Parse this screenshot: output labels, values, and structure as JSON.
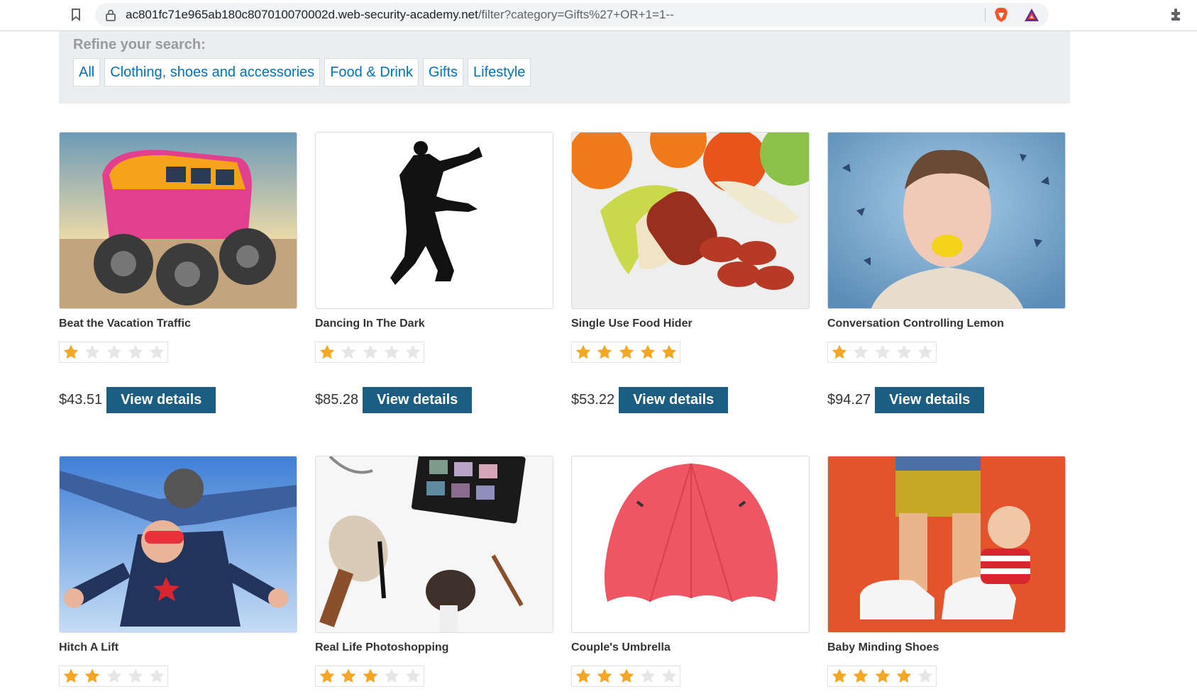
{
  "browser": {
    "url_host": "ac801fc71e965ab180c807010070002d.web-security-academy.net",
    "url_path": "/filter?category=Gifts%27+OR+1=1--",
    "icons": [
      "bookmark-icon",
      "lock-icon",
      "brave-shield-icon",
      "bat-rewards-icon",
      "extensions-icon"
    ]
  },
  "filter": {
    "title": "Refine your search:",
    "categories": [
      "All",
      "Clothing, shoes and accessories",
      "Food & Drink",
      "Gifts",
      "Lifestyle"
    ]
  },
  "colors": {
    "link": "#0071bc",
    "button": "#1b5e82",
    "star_filled": "#f5a623",
    "star_empty": "#e6e6e6",
    "panel_bg": "#ebeef0"
  },
  "products": [
    {
      "name": "Beat the Vacation Traffic",
      "rating": 1,
      "max_rating": 5,
      "price": "$43.51",
      "button": "View details"
    },
    {
      "name": "Dancing In The Dark",
      "rating": 1,
      "max_rating": 5,
      "price": "$85.28",
      "button": "View details"
    },
    {
      "name": "Single Use Food Hider",
      "rating": 5,
      "max_rating": 5,
      "price": "$53.22",
      "button": "View details"
    },
    {
      "name": "Conversation Controlling Lemon",
      "rating": 1,
      "max_rating": 5,
      "price": "$94.27",
      "button": "View details"
    },
    {
      "name": "Hitch A Lift",
      "rating": 2,
      "max_rating": 5
    },
    {
      "name": "Real Life Photoshopping",
      "rating": 3,
      "max_rating": 5
    },
    {
      "name": "Couple's Umbrella",
      "rating": 3,
      "max_rating": 5
    },
    {
      "name": "Baby Minding Shoes",
      "rating": 4,
      "max_rating": 5
    }
  ]
}
